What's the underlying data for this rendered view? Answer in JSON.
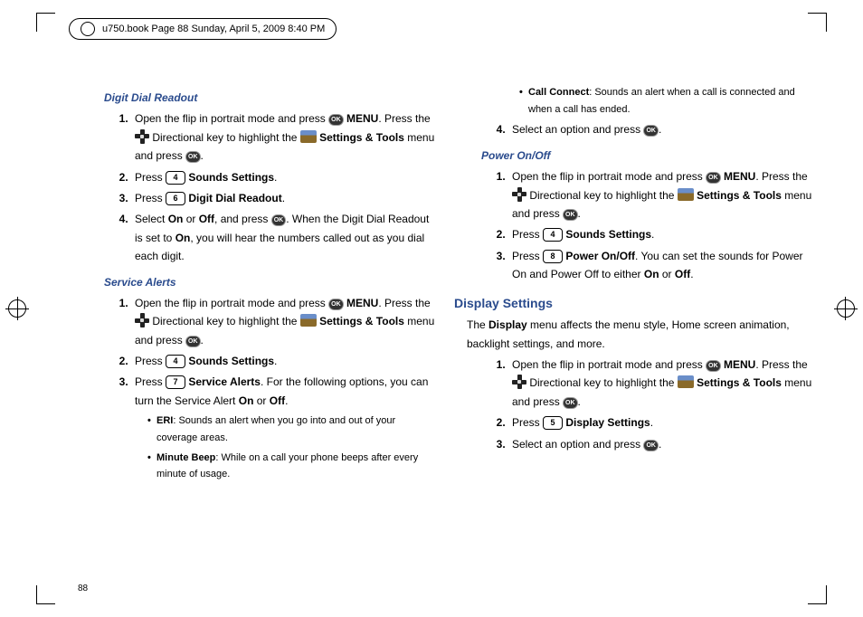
{
  "header": "u750.book  Page 88  Sunday, April 5, 2009  8:40 PM",
  "page_number": "88",
  "ok": "OK",
  "key4": "4",
  "key5": "5",
  "key6": "6",
  "key7": "7",
  "key8": "8",
  "left": {
    "s1": {
      "title": "Digit Dial Readout",
      "step1a": "Open the flip in portrait mode and press ",
      "step1b": " MENU",
      "step1c": ". Press the ",
      "step1d": " Directional key to highlight the ",
      "step1e": " Settings & Tools",
      "step1f": " menu and press ",
      "step1g": ".",
      "step2a": "Press ",
      "step2b": " Sounds Settings",
      "step2c": ".",
      "step3a": "Press ",
      "step3b": " Digit Dial Readout",
      "step3c": ".",
      "step4a": "Select ",
      "step4b": "On",
      "step4c": " or ",
      "step4d": "Off",
      "step4e": ", and press ",
      "step4f": ". When the Digit Dial Readout is set to ",
      "step4g": "On",
      "step4h": ", you will hear the numbers called out as you dial each digit."
    },
    "s2": {
      "title": "Service Alerts",
      "step3a": "Press ",
      "step3b": " Service Alerts",
      "step3c": ". For the following options, you can turn the Service Alert ",
      "step3d": "On",
      "step3e": " or ",
      "step3f": "Off",
      "step3g": ".",
      "b1a": "ERI",
      "b1b": ": Sounds an alert when you go into and out of your coverage areas.",
      "b2a": "Minute Beep",
      "b2b": ": While on a call your phone beeps after every minute of usage."
    }
  },
  "right": {
    "c1a": "Call Connect",
    "c1b": ": Sounds an alert when a call is connected and when a call has ended.",
    "step4a": "Select an option and press ",
    "step4b": ".",
    "s3": {
      "title": "Power On/Off",
      "step3a": "Press ",
      "step3b": " Power On/Off",
      "step3c": ". You can set the sounds for Power On and Power Off to either ",
      "step3d": "On",
      "step3e": " or ",
      "step3f": "Off",
      "step3g": "."
    },
    "ds": {
      "title": "Display Settings",
      "intro1": "The ",
      "intro2": "Display",
      "intro3": " menu affects the menu style, Home screen animation, backlight settings, and more.",
      "step2a": "Press ",
      "step2b": " Display Settings",
      "step2c": ".",
      "step3a": "Select an option and press ",
      "step3b": "."
    }
  }
}
